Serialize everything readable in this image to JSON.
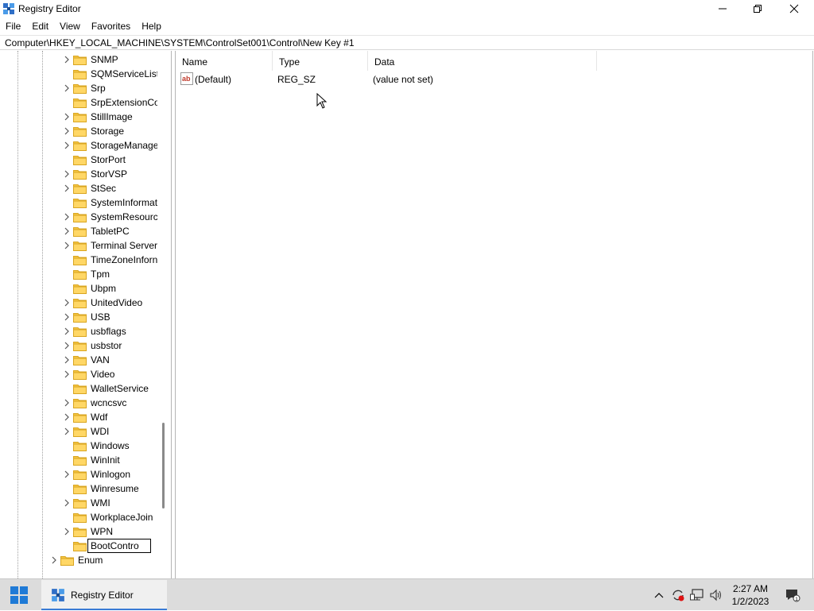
{
  "window": {
    "title": "Registry Editor",
    "minimize_label": "Minimize",
    "maximize_label": "Restore",
    "close_label": "Close"
  },
  "menu": [
    "File",
    "Edit",
    "View",
    "Favorites",
    "Help"
  ],
  "address": "Computer\\HKEY_LOCAL_MACHINE\\SYSTEM\\ControlSet001\\Control\\New Key #1",
  "tree": {
    "nodes": [
      {
        "label": "SNMP",
        "expandable": true
      },
      {
        "label": "SQMServiceList",
        "expandable": false
      },
      {
        "label": "Srp",
        "expandable": true
      },
      {
        "label": "SrpExtensionCo",
        "expandable": false
      },
      {
        "label": "StillImage",
        "expandable": true
      },
      {
        "label": "Storage",
        "expandable": true
      },
      {
        "label": "StorageManage",
        "expandable": true
      },
      {
        "label": "StorPort",
        "expandable": false
      },
      {
        "label": "StorVSP",
        "expandable": true
      },
      {
        "label": "StSec",
        "expandable": true
      },
      {
        "label": "SystemInformat",
        "expandable": false
      },
      {
        "label": "SystemResource",
        "expandable": true
      },
      {
        "label": "TabletPC",
        "expandable": true
      },
      {
        "label": "Terminal Server",
        "expandable": true
      },
      {
        "label": "TimeZoneInforn",
        "expandable": false
      },
      {
        "label": "Tpm",
        "expandable": false
      },
      {
        "label": "Ubpm",
        "expandable": false
      },
      {
        "label": "UnitedVideo",
        "expandable": true
      },
      {
        "label": "USB",
        "expandable": true
      },
      {
        "label": "usbflags",
        "expandable": true
      },
      {
        "label": "usbstor",
        "expandable": true
      },
      {
        "label": "VAN",
        "expandable": true
      },
      {
        "label": "Video",
        "expandable": true
      },
      {
        "label": "WalletService",
        "expandable": false
      },
      {
        "label": "wcncsvc",
        "expandable": true
      },
      {
        "label": "Wdf",
        "expandable": true
      },
      {
        "label": "WDI",
        "expandable": true
      },
      {
        "label": "Windows",
        "expandable": false
      },
      {
        "label": "WinInit",
        "expandable": false
      },
      {
        "label": "Winlogon",
        "expandable": true
      },
      {
        "label": "Winresume",
        "expandable": false
      },
      {
        "label": "WMI",
        "expandable": true
      },
      {
        "label": "WorkplaceJoin",
        "expandable": false
      },
      {
        "label": "WPN",
        "expandable": true
      }
    ],
    "rename_value": "BootContro",
    "enum_label": "Enum"
  },
  "list": {
    "columns": [
      "Name",
      "Type",
      "Data"
    ],
    "rows": [
      {
        "name": "(Default)",
        "type": "REG_SZ",
        "data": "(value not set)"
      }
    ]
  },
  "taskbar": {
    "app_label": "Registry Editor",
    "time": "2:27 AM",
    "date": "1/2/2023",
    "notification_count": "1"
  },
  "icons": {
    "app": "registry-editor-icon",
    "folder": "folder-icon",
    "chevron": "chevron-right-icon",
    "string_value": "string-value-icon",
    "start": "windows-start-icon"
  },
  "colors": {
    "folder": "#f5c542",
    "accent": "#3a7bd5",
    "taskbar": "#dcdcdc"
  }
}
